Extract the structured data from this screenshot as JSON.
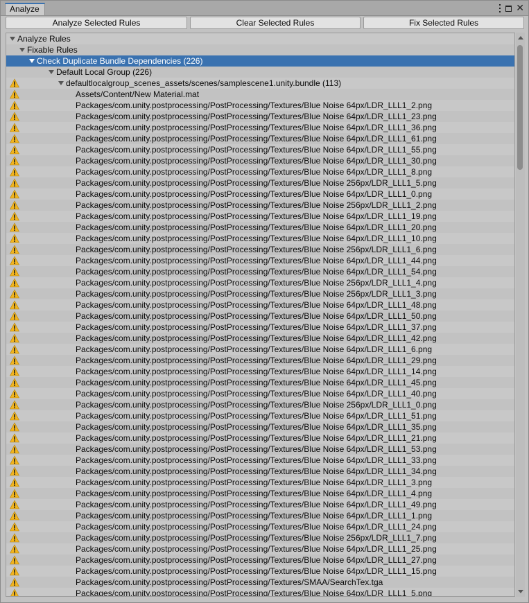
{
  "window": {
    "tab_title": "Analyze"
  },
  "toolbar": {
    "analyze_label": "Analyze Selected Rules",
    "clear_label": "Clear Selected Rules",
    "fix_label": "Fix Selected Rules"
  },
  "tree": {
    "root": "Analyze Rules",
    "fixable": "Fixable Rules",
    "rule": "Check Duplicate Bundle Dependencies (226)",
    "group": "Default Local Group (226)",
    "bundle": "defaultlocalgroup_scenes_assets/scenes/samplescene1.unity.bundle (113)",
    "assets": [
      "Assets/Content/New Material.mat",
      "Packages/com.unity.postprocessing/PostProcessing/Textures/Blue Noise 64px/LDR_LLL1_2.png",
      "Packages/com.unity.postprocessing/PostProcessing/Textures/Blue Noise 64px/LDR_LLL1_23.png",
      "Packages/com.unity.postprocessing/PostProcessing/Textures/Blue Noise 64px/LDR_LLL1_36.png",
      "Packages/com.unity.postprocessing/PostProcessing/Textures/Blue Noise 64px/LDR_LLL1_61.png",
      "Packages/com.unity.postprocessing/PostProcessing/Textures/Blue Noise 64px/LDR_LLL1_55.png",
      "Packages/com.unity.postprocessing/PostProcessing/Textures/Blue Noise 64px/LDR_LLL1_30.png",
      "Packages/com.unity.postprocessing/PostProcessing/Textures/Blue Noise 64px/LDR_LLL1_8.png",
      "Packages/com.unity.postprocessing/PostProcessing/Textures/Blue Noise 256px/LDR_LLL1_5.png",
      "Packages/com.unity.postprocessing/PostProcessing/Textures/Blue Noise 64px/LDR_LLL1_0.png",
      "Packages/com.unity.postprocessing/PostProcessing/Textures/Blue Noise 256px/LDR_LLL1_2.png",
      "Packages/com.unity.postprocessing/PostProcessing/Textures/Blue Noise 64px/LDR_LLL1_19.png",
      "Packages/com.unity.postprocessing/PostProcessing/Textures/Blue Noise 64px/LDR_LLL1_20.png",
      "Packages/com.unity.postprocessing/PostProcessing/Textures/Blue Noise 64px/LDR_LLL1_10.png",
      "Packages/com.unity.postprocessing/PostProcessing/Textures/Blue Noise 256px/LDR_LLL1_6.png",
      "Packages/com.unity.postprocessing/PostProcessing/Textures/Blue Noise 64px/LDR_LLL1_44.png",
      "Packages/com.unity.postprocessing/PostProcessing/Textures/Blue Noise 64px/LDR_LLL1_54.png",
      "Packages/com.unity.postprocessing/PostProcessing/Textures/Blue Noise 256px/LDR_LLL1_4.png",
      "Packages/com.unity.postprocessing/PostProcessing/Textures/Blue Noise 256px/LDR_LLL1_3.png",
      "Packages/com.unity.postprocessing/PostProcessing/Textures/Blue Noise 64px/LDR_LLL1_48.png",
      "Packages/com.unity.postprocessing/PostProcessing/Textures/Blue Noise 64px/LDR_LLL1_50.png",
      "Packages/com.unity.postprocessing/PostProcessing/Textures/Blue Noise 64px/LDR_LLL1_37.png",
      "Packages/com.unity.postprocessing/PostProcessing/Textures/Blue Noise 64px/LDR_LLL1_42.png",
      "Packages/com.unity.postprocessing/PostProcessing/Textures/Blue Noise 64px/LDR_LLL1_6.png",
      "Packages/com.unity.postprocessing/PostProcessing/Textures/Blue Noise 64px/LDR_LLL1_29.png",
      "Packages/com.unity.postprocessing/PostProcessing/Textures/Blue Noise 64px/LDR_LLL1_14.png",
      "Packages/com.unity.postprocessing/PostProcessing/Textures/Blue Noise 64px/LDR_LLL1_45.png",
      "Packages/com.unity.postprocessing/PostProcessing/Textures/Blue Noise 64px/LDR_LLL1_40.png",
      "Packages/com.unity.postprocessing/PostProcessing/Textures/Blue Noise 256px/LDR_LLL1_0.png",
      "Packages/com.unity.postprocessing/PostProcessing/Textures/Blue Noise 64px/LDR_LLL1_51.png",
      "Packages/com.unity.postprocessing/PostProcessing/Textures/Blue Noise 64px/LDR_LLL1_35.png",
      "Packages/com.unity.postprocessing/PostProcessing/Textures/Blue Noise 64px/LDR_LLL1_21.png",
      "Packages/com.unity.postprocessing/PostProcessing/Textures/Blue Noise 64px/LDR_LLL1_53.png",
      "Packages/com.unity.postprocessing/PostProcessing/Textures/Blue Noise 64px/LDR_LLL1_33.png",
      "Packages/com.unity.postprocessing/PostProcessing/Textures/Blue Noise 64px/LDR_LLL1_34.png",
      "Packages/com.unity.postprocessing/PostProcessing/Textures/Blue Noise 64px/LDR_LLL1_3.png",
      "Packages/com.unity.postprocessing/PostProcessing/Textures/Blue Noise 64px/LDR_LLL1_4.png",
      "Packages/com.unity.postprocessing/PostProcessing/Textures/Blue Noise 64px/LDR_LLL1_49.png",
      "Packages/com.unity.postprocessing/PostProcessing/Textures/Blue Noise 64px/LDR_LLL1_1.png",
      "Packages/com.unity.postprocessing/PostProcessing/Textures/Blue Noise 64px/LDR_LLL1_24.png",
      "Packages/com.unity.postprocessing/PostProcessing/Textures/Blue Noise 256px/LDR_LLL1_7.png",
      "Packages/com.unity.postprocessing/PostProcessing/Textures/Blue Noise 64px/LDR_LLL1_25.png",
      "Packages/com.unity.postprocessing/PostProcessing/Textures/Blue Noise 64px/LDR_LLL1_27.png",
      "Packages/com.unity.postprocessing/PostProcessing/Textures/Blue Noise 64px/LDR_LLL1_15.png",
      "Packages/com.unity.postprocessing/PostProcessing/Textures/SMAA/SearchTex.tga",
      "Packages/com.unity.postprocessing/PostProcessing/Textures/Blue Noise 64px/LDR_LLL1_5.png"
    ]
  },
  "colors": {
    "selection": "#3a72b0",
    "warning_fill": "#f2b51e",
    "warning_mark": "#1a1a1a"
  }
}
